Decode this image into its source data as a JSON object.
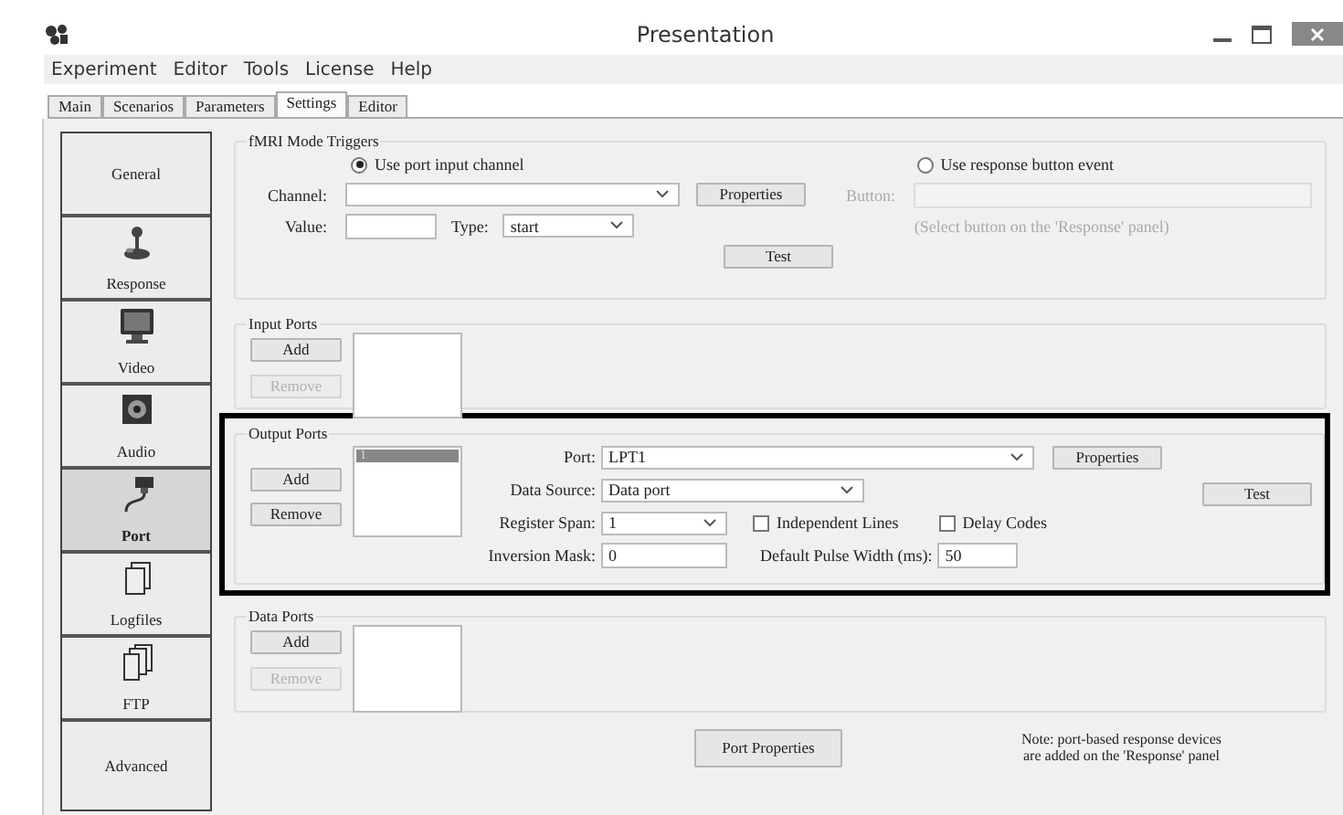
{
  "window": {
    "title": "Presentation"
  },
  "menu": [
    "Experiment",
    "Editor",
    "Tools",
    "License",
    "Help"
  ],
  "tabs": [
    {
      "label": "Main",
      "selected": false
    },
    {
      "label": "Scenarios",
      "selected": false
    },
    {
      "label": "Parameters",
      "selected": false
    },
    {
      "label": "Settings",
      "selected": true
    },
    {
      "label": "Editor",
      "selected": false
    }
  ],
  "sidebar": {
    "items": [
      {
        "label": "General",
        "selected": false
      },
      {
        "label": "Response",
        "selected": false
      },
      {
        "label": "Video",
        "selected": false
      },
      {
        "label": "Audio",
        "selected": false
      },
      {
        "label": "Port",
        "selected": true
      },
      {
        "label": "Logfiles",
        "selected": false
      },
      {
        "label": "FTP",
        "selected": false
      },
      {
        "label": "Advanced",
        "selected": false
      }
    ]
  },
  "fmri_triggers": {
    "title": "fMRI Mode Triggers",
    "options": [
      {
        "label": "Use port input channel",
        "selected": true
      },
      {
        "label": "Use response button event",
        "selected": false
      }
    ],
    "channel": {
      "label": "Channel:"
    },
    "properties_button": "Properties",
    "button_field": {
      "label": "Button:",
      "disabled": true
    },
    "value": {
      "label": "Value:"
    },
    "type": {
      "label": "Type:",
      "value": "start"
    },
    "note": {
      "text": "(Select button on the 'Response' panel)",
      "disabled": true
    },
    "test_button": "Test"
  },
  "input_ports": {
    "title": "Input Ports",
    "buttons": [
      {
        "label": "Add",
        "disabled": false
      },
      {
        "label": "Remove",
        "disabled": true
      }
    ]
  },
  "output_ports": {
    "title": "Output Ports",
    "highlighted": true,
    "buttons": [
      {
        "label": "Add",
        "disabled": false
      },
      {
        "label": "Remove",
        "disabled": false
      }
    ],
    "list": [
      {
        "label": "1",
        "selected": true
      }
    ],
    "port": {
      "label": "Port:",
      "value": "LPT1"
    },
    "properties_button": "Properties",
    "data_source": {
      "label": "Data Source:",
      "value": "Data port"
    },
    "register_span": {
      "label": "Register Span:",
      "value": "1"
    },
    "checkboxes": [
      {
        "label": "Independent Lines",
        "checked": false
      },
      {
        "label": "Delay Codes",
        "checked": false
      }
    ],
    "inversion_mask": {
      "label": "Inversion Mask:",
      "value": "0"
    },
    "pulse_width": {
      "label": "Default Pulse Width (ms):",
      "value": "50"
    },
    "test_button": "Test"
  },
  "data_ports": {
    "title": "Data Ports",
    "buttons": [
      {
        "label": "Add",
        "disabled": false
      },
      {
        "label": "Remove",
        "disabled": true
      }
    ]
  },
  "port_properties_button": "Port Properties",
  "note": "Note: port-based response devices\nare added on the 'Response' panel"
}
